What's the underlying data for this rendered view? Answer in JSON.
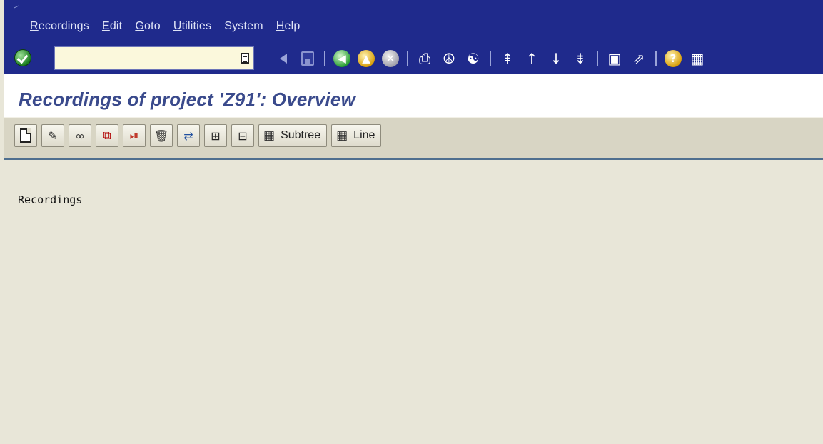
{
  "menubar": {
    "items": [
      {
        "mnemonic": "R",
        "rest": "ecordings"
      },
      {
        "mnemonic": "E",
        "rest": "dit"
      },
      {
        "mnemonic": "G",
        "rest": "oto"
      },
      {
        "mnemonic": "U",
        "rest": "tilities"
      },
      {
        "mnemonic": "",
        "rest": "System"
      },
      {
        "mnemonic": "H",
        "rest": "elp"
      }
    ]
  },
  "stdbar": {
    "command_field": {
      "value": "",
      "placeholder": ""
    },
    "icons": [
      "enter-icon",
      "save-icon",
      "back-icon",
      "exit-icon",
      "cancel-icon",
      "print-icon",
      "find-icon",
      "find-next-icon",
      "first-page-icon",
      "previous-page-icon",
      "next-page-icon",
      "last-page-icon",
      "create-session-icon",
      "shortcut-icon",
      "help-icon",
      "layout-menu-icon"
    ]
  },
  "title": "Recordings of project 'Z91': Overview",
  "appbar": {
    "subtree_label": "Subtree",
    "line_label": "Line",
    "icons": [
      "new-icon",
      "edit-icon",
      "display-icon",
      "copy-icon",
      "execute-icon",
      "delete-icon",
      "transport-icon",
      "expand-icon",
      "collapse-icon"
    ]
  },
  "content": {
    "tree_root": "Recordings"
  },
  "colors": {
    "menubar_bg": "#1f2a8c",
    "title_text": "#3a4a8c",
    "content_bg": "#e8e6d8"
  }
}
